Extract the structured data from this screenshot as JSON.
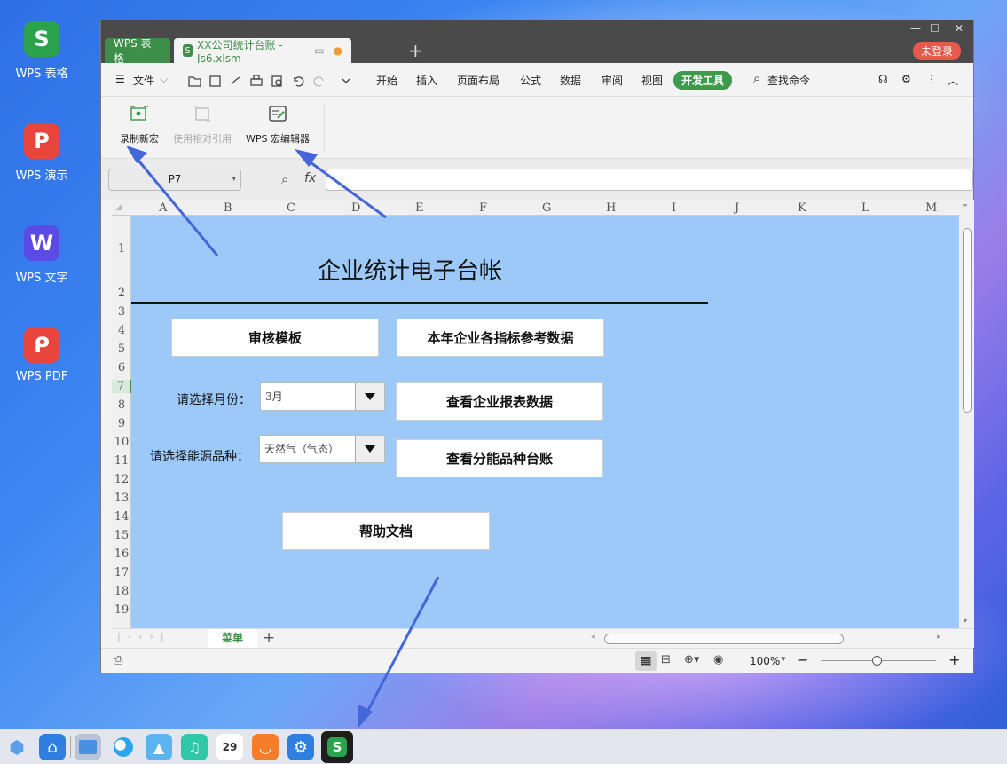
{
  "desktop": {
    "icons": [
      {
        "label": "WPS 表格",
        "glyph": "S",
        "color": "#2ba24c"
      },
      {
        "label": "WPS 演示",
        "glyph": "P",
        "color": "#e8453c"
      },
      {
        "label": "WPS 文字",
        "glyph": "W",
        "color": "#5a4be6"
      },
      {
        "label": "WPS PDF",
        "glyph": "ᑭ",
        "color": "#e8453c"
      }
    ]
  },
  "window": {
    "tabs": [
      {
        "label": "WPS 表格"
      },
      {
        "label": "XX公司统计台账 - Js6.xlsm"
      }
    ],
    "login": "未登录"
  },
  "menu": {
    "file": "文件",
    "items": [
      "开始",
      "插入",
      "页面布局",
      "公式",
      "数据",
      "审阅",
      "视图"
    ],
    "active": "开发工具",
    "search": "查找命令"
  },
  "ribbon": {
    "record": "录制新宏",
    "relative": "使用相对引用",
    "editor": "WPS 宏编辑器"
  },
  "formula": {
    "cell": "P7",
    "fx": "fx"
  },
  "columns": [
    "A",
    "B",
    "C",
    "D",
    "E",
    "F",
    "G",
    "H",
    "I",
    "J",
    "K",
    "L",
    "M"
  ],
  "rows": [
    "1",
    "2",
    "3",
    "4",
    "5",
    "6",
    "7",
    "8",
    "9",
    "10",
    "11",
    "12",
    "13",
    "14",
    "15",
    "16",
    "17",
    "18",
    "19"
  ],
  "sheet": {
    "title": "企业统计电子台帐",
    "btn_audit": "审核模板",
    "btn_ref": "本年企业各指标参考数据",
    "btn_report": "查看企业报表数据",
    "btn_energy": "查看分能品种台账",
    "btn_help": "帮助文档",
    "month_label": "请选择月份：",
    "month_value": "3月",
    "energy_label": "请选择能源品种：",
    "energy_value": "天然气（气态）"
  },
  "sheettab": "菜单",
  "status": {
    "zoom": "100%"
  },
  "taskbar": {
    "calendar_day": "29"
  }
}
